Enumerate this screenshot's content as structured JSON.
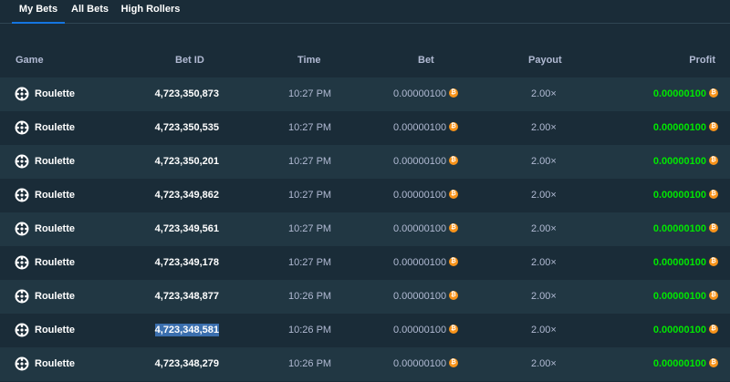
{
  "tabs": [
    {
      "label": "My Bets",
      "active": true
    },
    {
      "label": "All Bets",
      "active": false
    },
    {
      "label": "High Rollers",
      "active": false
    }
  ],
  "columns": {
    "game": "Game",
    "bet_id": "Bet ID",
    "time": "Time",
    "bet": "Bet",
    "payout": "Payout",
    "profit": "Profit"
  },
  "coin_icon": "bitcoin-icon",
  "colors": {
    "background": "#1a2c38",
    "row_alt": "#213743",
    "profit": "#00e701",
    "accent": "#1475e1",
    "coin": "#f7931a"
  },
  "rows": [
    {
      "game": "Roulette",
      "bet_id": "4,723,350,873",
      "time": "10:27 PM",
      "bet": "0.00000100",
      "payout": "2.00×",
      "profit": "0.00000100",
      "selected": false
    },
    {
      "game": "Roulette",
      "bet_id": "4,723,350,535",
      "time": "10:27 PM",
      "bet": "0.00000100",
      "payout": "2.00×",
      "profit": "0.00000100",
      "selected": false
    },
    {
      "game": "Roulette",
      "bet_id": "4,723,350,201",
      "time": "10:27 PM",
      "bet": "0.00000100",
      "payout": "2.00×",
      "profit": "0.00000100",
      "selected": false
    },
    {
      "game": "Roulette",
      "bet_id": "4,723,349,862",
      "time": "10:27 PM",
      "bet": "0.00000100",
      "payout": "2.00×",
      "profit": "0.00000100",
      "selected": false
    },
    {
      "game": "Roulette",
      "bet_id": "4,723,349,561",
      "time": "10:27 PM",
      "bet": "0.00000100",
      "payout": "2.00×",
      "profit": "0.00000100",
      "selected": false
    },
    {
      "game": "Roulette",
      "bet_id": "4,723,349,178",
      "time": "10:27 PM",
      "bet": "0.00000100",
      "payout": "2.00×",
      "profit": "0.00000100",
      "selected": false
    },
    {
      "game": "Roulette",
      "bet_id": "4,723,348,877",
      "time": "10:26 PM",
      "bet": "0.00000100",
      "payout": "2.00×",
      "profit": "0.00000100",
      "selected": false
    },
    {
      "game": "Roulette",
      "bet_id": "4,723,348,581",
      "time": "10:26 PM",
      "bet": "0.00000100",
      "payout": "2.00×",
      "profit": "0.00000100",
      "selected": true
    },
    {
      "game": "Roulette",
      "bet_id": "4,723,348,279",
      "time": "10:26 PM",
      "bet": "0.00000100",
      "payout": "2.00×",
      "profit": "0.00000100",
      "selected": false
    }
  ]
}
